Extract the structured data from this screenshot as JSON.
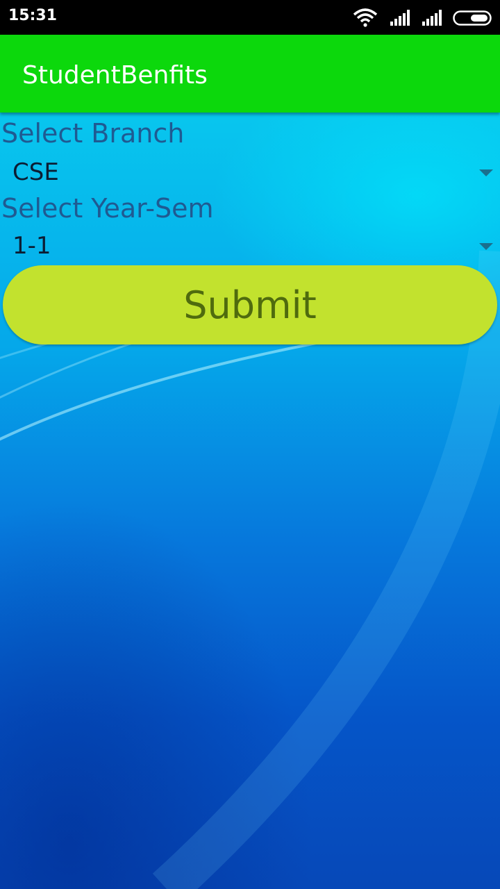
{
  "status_bar": {
    "time": "15:31",
    "icons": [
      "wifi-icon",
      "signal-icon",
      "signal-icon",
      "battery-icon"
    ]
  },
  "app_bar": {
    "title": "StudentBenfits",
    "color": "#0cd80c"
  },
  "form": {
    "branch_label": "Select Branch",
    "branch_value": "CSE",
    "yearsem_label": "Select Year-Sem",
    "yearsem_value": "1-1",
    "submit_label": "Submit",
    "submit_color": "#c2e22e"
  }
}
